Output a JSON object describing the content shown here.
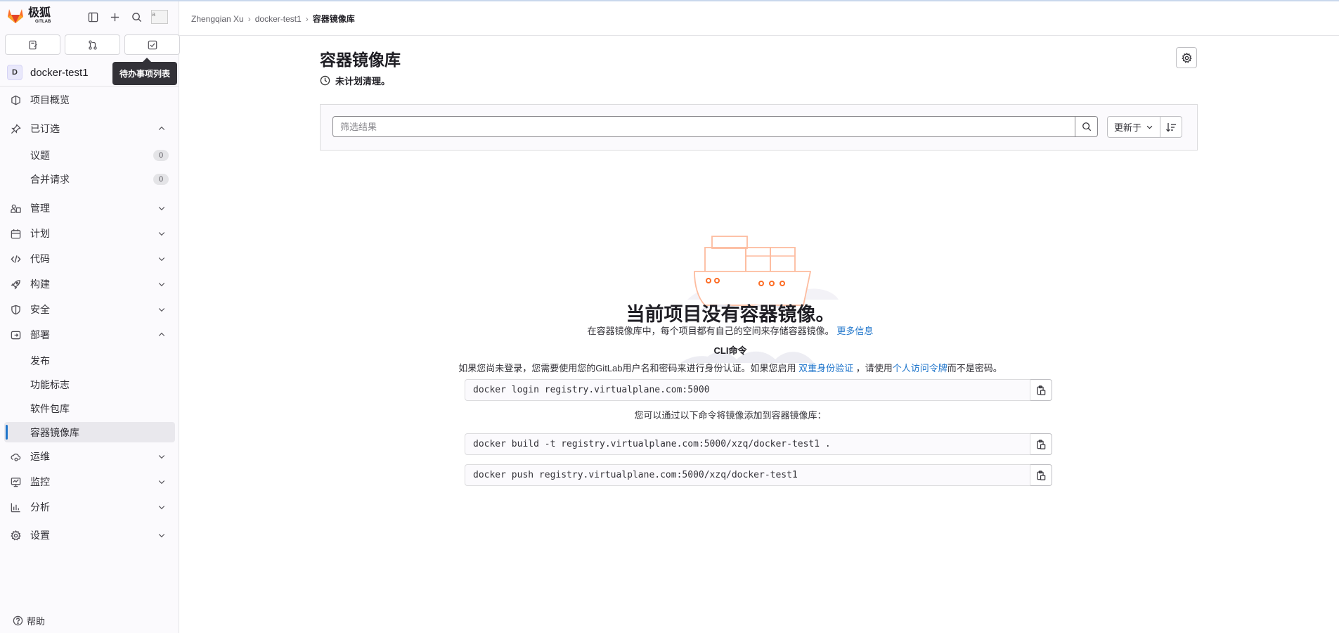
{
  "brand": {
    "name": "极狐",
    "sub": "GITLAB"
  },
  "top_icons": [
    "sidebar-toggle-icon",
    "plus-icon",
    "search-icon"
  ],
  "avatar": {
    "alt": "a"
  },
  "sidebar_tabs": [
    "issues-icon",
    "merge-request-icon",
    "todo-icon"
  ],
  "tooltip": "待办事项列表",
  "project": {
    "initial": "D",
    "name": "docker-test1"
  },
  "nav": {
    "overview": "项目概览",
    "pinned": "已订选",
    "pinned_items": [
      {
        "label": "议题",
        "count": "0"
      },
      {
        "label": "合并请求",
        "count": "0"
      }
    ],
    "manage": "管理",
    "plan": "计划",
    "code": "代码",
    "build": "构建",
    "secure": "安全",
    "deploy": "部署",
    "deploy_items": [
      "发布",
      "功能标志",
      "软件包库",
      "容器镜像库"
    ],
    "operate": "运维",
    "monitor": "监控",
    "analyze": "分析",
    "settings": "设置",
    "help": "帮助"
  },
  "breadcrumb": [
    "Zhengqian Xu",
    "docker-test1",
    "容器镜像库"
  ],
  "page": {
    "title": "容器镜像库",
    "cleanup_status": "未计划清理。"
  },
  "filter": {
    "placeholder": "筛选结果",
    "sort_label": "更新于"
  },
  "empty_state": {
    "title": "当前项目没有容器镜像。",
    "description": "在容器镜像库中，每个项目都有自己的空间来存储容器镜像。",
    "more_info": "更多信息",
    "cli_title": "CLI命令",
    "login_note_1": "如果您尚未登录，您需要使用您的GitLab用户名和密码来进行身份认证。如果您启用",
    "login_note_link1": "双重身份验证",
    "login_note_2": "，请使用",
    "login_note_link2": "个人访问令牌",
    "login_note_3": "而不是密码。",
    "add_note": "您可以通过以下命令将镜像添加到容器镜像库：",
    "commands": [
      "docker login registry.virtualplane.com:5000",
      "docker build -t registry.virtualplane.com:5000/xzq/docker-test1 .",
      "docker push registry.virtualplane.com:5000/xzq/docker-test1"
    ]
  },
  "colors": {
    "link": "#1f75cb",
    "active_bar": "#1f75cb",
    "illustration_accent": "#fc6d26"
  }
}
